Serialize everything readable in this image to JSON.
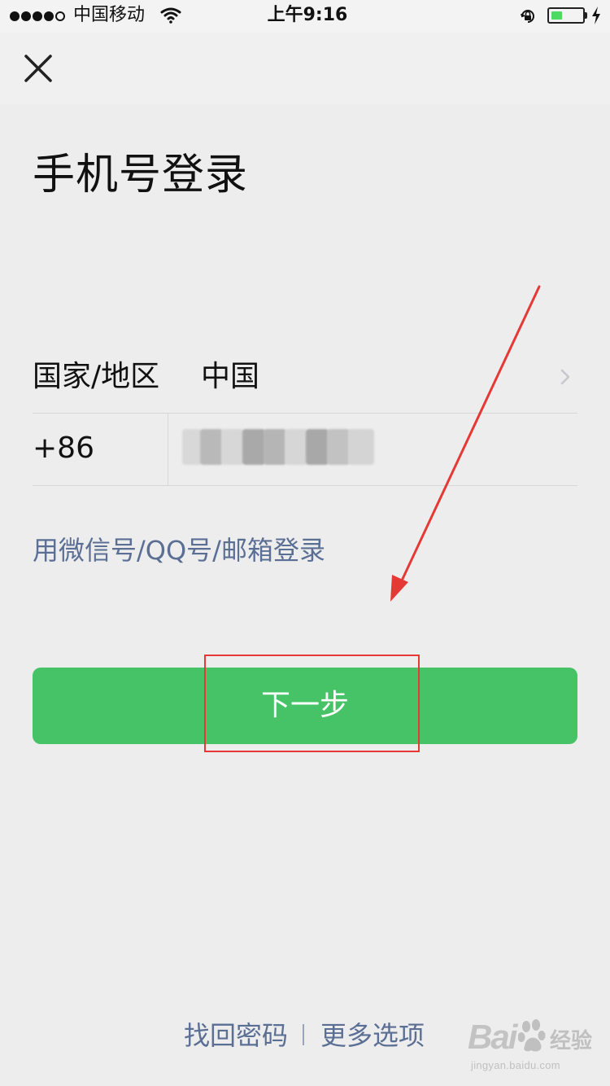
{
  "status_bar": {
    "carrier": "中国移动",
    "time": "上午9:16",
    "battery_level": 0.35,
    "icons": [
      "signal-icon",
      "wifi-icon",
      "orientation-lock-icon",
      "battery-icon",
      "charging-icon"
    ]
  },
  "nav": {
    "close_icon": "close-icon"
  },
  "login": {
    "title": "手机号登录",
    "country_label": "国家/地区",
    "country_value": "中国",
    "country_code": "+86",
    "phone_value": "",
    "alternate_login": "用微信号/QQ号/邮箱登录",
    "next_button": "下一步"
  },
  "footer": {
    "retrieve_password": "找回密码",
    "more_options": "更多选项"
  },
  "watermark": {
    "brand": "Bai",
    "product": "经验",
    "url": "jingyan.baidu.com"
  },
  "colors": {
    "primary": "#46c267",
    "link": "#5b6f95",
    "background": "#ededed",
    "annotation": "#e53935"
  }
}
